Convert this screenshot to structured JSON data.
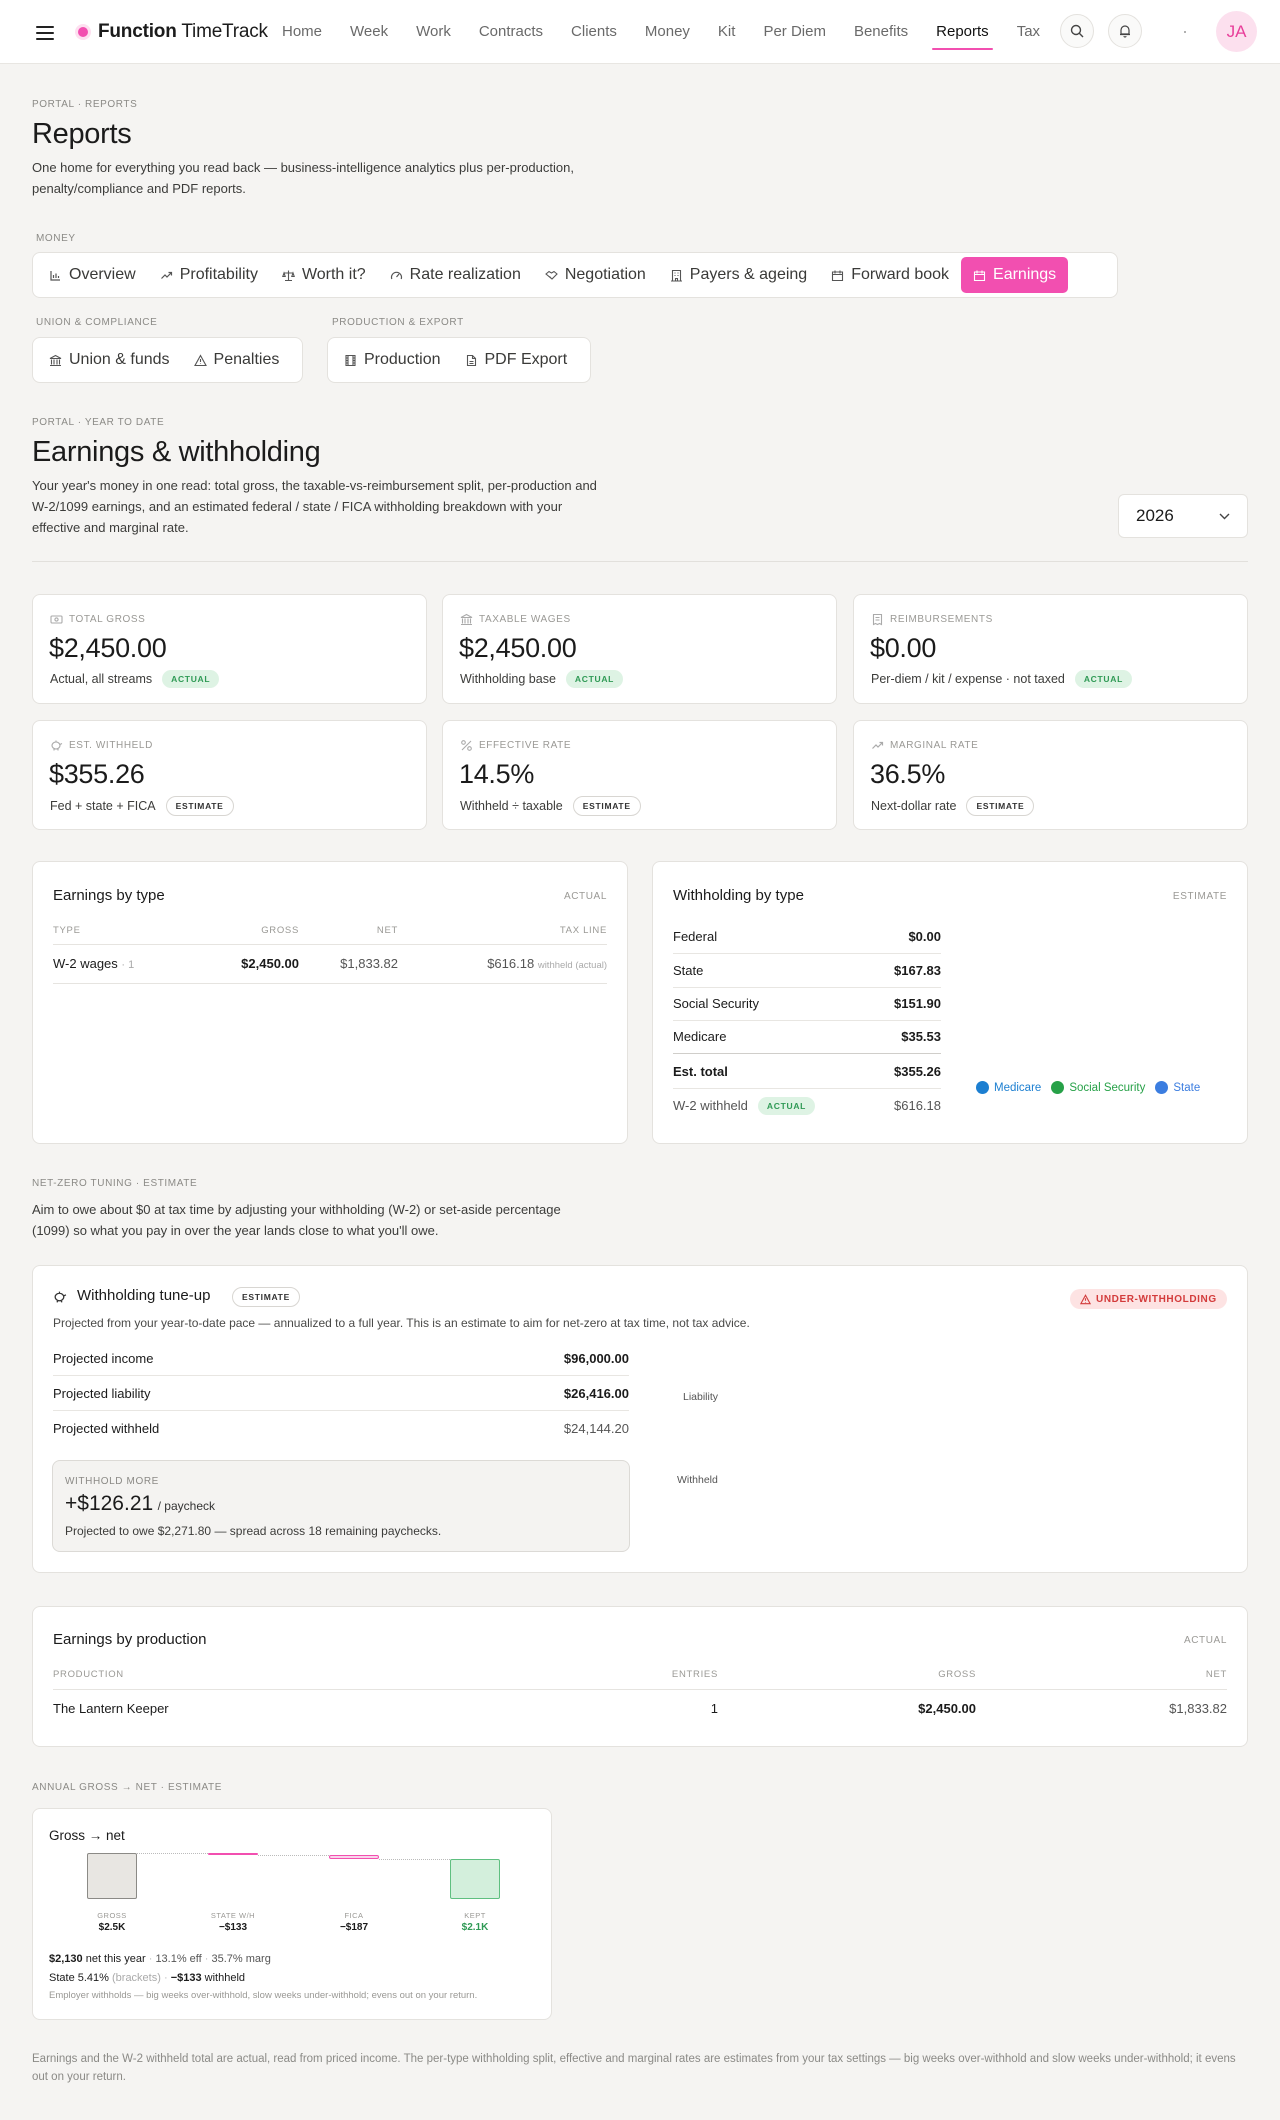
{
  "nav": {
    "brand_bold": "Function",
    "brand_rest": " TimeTrack",
    "links": [
      "Home",
      "Week",
      "Work",
      "Contracts",
      "Clients",
      "Money",
      "Kit",
      "Per Diem",
      "Benefits",
      "Reports",
      "Tax"
    ],
    "active": "Reports",
    "avatar": "JA"
  },
  "header": {
    "eyebrow": "PORTAL · REPORTS",
    "title": "Reports",
    "lead": "One home for everything you read back — business-intelligence analytics plus per-production, penalty/compliance and PDF reports."
  },
  "tabs": {
    "money_label": "MONEY",
    "money": [
      {
        "label": "Overview",
        "icon": "bar-chart-icon"
      },
      {
        "label": "Profitability",
        "icon": "trending-up-icon"
      },
      {
        "label": "Worth it?",
        "icon": "scale-icon"
      },
      {
        "label": "Rate realization",
        "icon": "gauge-icon"
      },
      {
        "label": "Negotiation",
        "icon": "handshake-icon"
      },
      {
        "label": "Payers & ageing",
        "icon": "building-icon"
      },
      {
        "label": "Forward book",
        "icon": "calendar-icon"
      },
      {
        "label": "Earnings",
        "icon": "wallet-icon"
      }
    ],
    "active": "Earnings",
    "union_label": "UNION & COMPLIANCE",
    "union": [
      {
        "label": "Union & funds",
        "icon": "landmark-icon"
      },
      {
        "label": "Penalties",
        "icon": "warning-icon"
      }
    ],
    "production_label": "PRODUCTION & EXPORT",
    "production": [
      {
        "label": "Production",
        "icon": "film-icon"
      },
      {
        "label": "PDF Export",
        "icon": "file-icon"
      }
    ]
  },
  "section": {
    "eyebrow": "PORTAL · YEAR TO DATE",
    "title": "Earnings & withholding",
    "lead": "Your year's money in one read: total gross, the taxable-vs-reimbursement split, per-production and W-2/1099 earnings, and an estimated federal / state / FICA withholding breakdown with your effective and marginal rate.",
    "year": "2026"
  },
  "kpis": [
    {
      "label": "TOTAL GROSS",
      "value": "$2,450.00",
      "sub": "Actual, all streams",
      "badge": "ACTUAL",
      "icon": "cash-icon"
    },
    {
      "label": "TAXABLE WAGES",
      "value": "$2,450.00",
      "sub": "Withholding base",
      "badge": "ACTUAL",
      "icon": "landmark-icon"
    },
    {
      "label": "REIMBURSEMENTS",
      "value": "$0.00",
      "sub": "Per-diem / kit / expense · not taxed",
      "badge": "ACTUAL",
      "icon": "receipt-icon"
    },
    {
      "label": "EST. WITHHELD",
      "value": "$355.26",
      "sub": "Fed + state + FICA",
      "badge": "ESTIMATE",
      "icon": "piggy-bank-icon"
    },
    {
      "label": "EFFECTIVE RATE",
      "value": "14.5%",
      "sub": "Withheld ÷ taxable",
      "badge": "ESTIMATE",
      "icon": "percent-icon"
    },
    {
      "label": "MARGINAL RATE",
      "value": "36.5%",
      "sub": "Next-dollar rate",
      "badge": "ESTIMATE",
      "icon": "trending-up-icon"
    }
  ],
  "earnings_by_type": {
    "title": "Earnings by type",
    "tag": "ACTUAL",
    "headers": [
      "TYPE",
      "GROSS",
      "NET",
      "TAX LINE"
    ],
    "rows": [
      {
        "type": "W-2 wages",
        "count": "· 1",
        "gross": "$2,450.00",
        "net": "$1,833.82",
        "tax": "$616.18",
        "tax_note": "withheld (actual)"
      }
    ]
  },
  "withholding_by_type": {
    "title": "Withholding by type",
    "tag": "ESTIMATE",
    "rows": [
      {
        "label": "Federal",
        "value": "$0.00"
      },
      {
        "label": "State",
        "value": "$167.83"
      },
      {
        "label": "Social Security",
        "value": "$151.90"
      },
      {
        "label": "Medicare",
        "value": "$35.53"
      }
    ],
    "total_label": "Est. total",
    "total_value": "$355.26",
    "w2_label": "W-2 withheld",
    "w2_badge": "ACTUAL",
    "w2_value": "$616.18",
    "legend": [
      {
        "label": "Medicare",
        "color": "#1c7fd1"
      },
      {
        "label": "Social Security",
        "color": "#27a148"
      },
      {
        "label": "State",
        "color": "#3b7de0"
      }
    ]
  },
  "netzero": {
    "eyebrow": "NET-ZERO TUNING · ESTIMATE",
    "lead": "Aim to owe about $0 at tax time by adjusting your withholding (W-2) or set-aside percentage (1099) so what you pay in over the year lands close to what you'll owe."
  },
  "tuneup": {
    "title": "Withholding tune-up",
    "badge": "ESTIMATE",
    "alert": "UNDER-WITHHOLDING",
    "desc": "Projected from your year-to-date pace — annualized to a full year. This is an estimate to aim for net-zero at tax time, not tax advice.",
    "rows": [
      {
        "label": "Projected income",
        "value": "$96,000.00",
        "bold": true
      },
      {
        "label": "Projected liability",
        "value": "$26,416.00",
        "bold": true
      },
      {
        "label": "Projected withheld",
        "value": "$24,144.20",
        "bold": false
      }
    ],
    "suggest_label": "WITHHOLD MORE",
    "suggest_value": "+$126.21",
    "suggest_unit": "/ paycheck",
    "suggest_note": "Projected to owe $2,271.80 — spread across 18 remaining paychecks.",
    "chart_labels": [
      "Liability",
      "Withheld"
    ]
  },
  "by_production": {
    "title": "Earnings by production",
    "tag": "ACTUAL",
    "headers": [
      "PRODUCTION",
      "ENTRIES",
      "GROSS",
      "NET"
    ],
    "rows": [
      {
        "production": "The Lantern Keeper",
        "entries": "1",
        "gross": "$2,450.00",
        "net": "$1,833.82"
      }
    ]
  },
  "annual": {
    "eyebrow": "ANNUAL GROSS → NET · ESTIMATE",
    "title": "Gross → net",
    "steps": [
      {
        "label": "GROSS",
        "value": "$2.5K"
      },
      {
        "label": "STATE W/H",
        "value": "−$133"
      },
      {
        "label": "FICA",
        "value": "−$187"
      },
      {
        "label": "KEPT",
        "value": "$2.1K"
      }
    ],
    "line1_net": "$2,130",
    "line1_text": " net this year",
    "line1_eff": "13.1% eff",
    "line1_marg": "35.7% marg",
    "line2_state": "State 5.41%",
    "line2_brackets": "(brackets)",
    "line2_withheld": "−$133",
    "line2_text": " withheld",
    "line3": "Employer withholds — big weeks over-withhold, slow weeks under-withhold; evens out on your return."
  },
  "footer": "Earnings and the W-2 withheld total are actual, read from priced income. The per-type withholding split, effective and marginal rates are estimates from your tax settings — big weeks over-withhold and slow weeks under-withhold; it evens out on your return.",
  "colors": {
    "accent": "#f24fb0",
    "actual": "#2f9a55",
    "alert": "#d33b3b"
  },
  "chart_data": {
    "type": "bar",
    "title": "Gross → net",
    "categories": [
      "GROSS",
      "STATE W/H",
      "FICA",
      "KEPT"
    ],
    "values": [
      2450,
      -133,
      -187,
      2130
    ],
    "value_labels": [
      "$2.5K",
      "−$133",
      "−$187",
      "$2.1K"
    ]
  }
}
